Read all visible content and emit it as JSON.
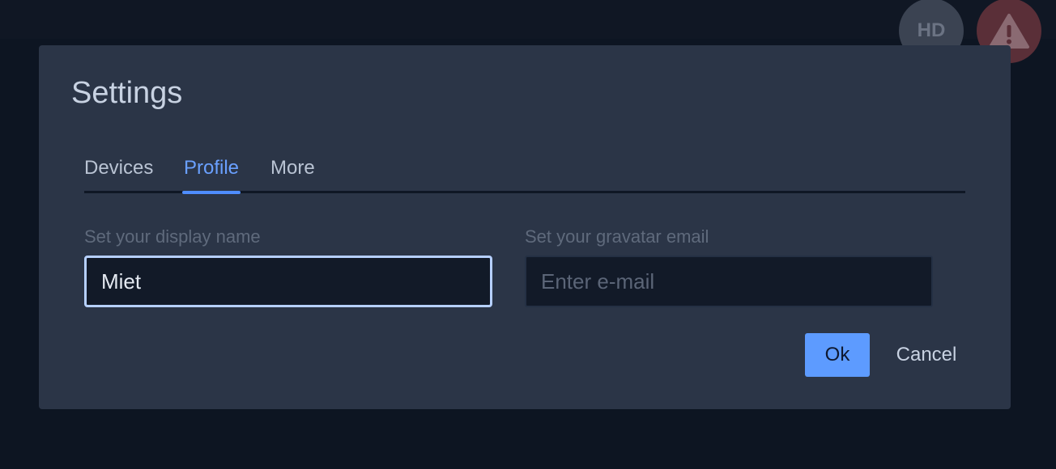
{
  "header": {
    "quality_badge": "HD",
    "warning_icon": "warning-triangle-icon"
  },
  "dialog": {
    "title": "Settings",
    "tabs": [
      {
        "label": "Devices",
        "active": false
      },
      {
        "label": "Profile",
        "active": true
      },
      {
        "label": "More",
        "active": false
      }
    ],
    "display_name": {
      "label": "Set your display name",
      "value": "Miet",
      "placeholder": ""
    },
    "gravatar_email": {
      "label": "Set your gravatar email",
      "value": "",
      "placeholder": "Enter e-mail"
    },
    "ok_label": "Ok",
    "cancel_label": "Cancel"
  },
  "colors": {
    "accent": "#5d9bff",
    "dialog_bg": "#2b3547",
    "page_bg": "#0c1320"
  }
}
